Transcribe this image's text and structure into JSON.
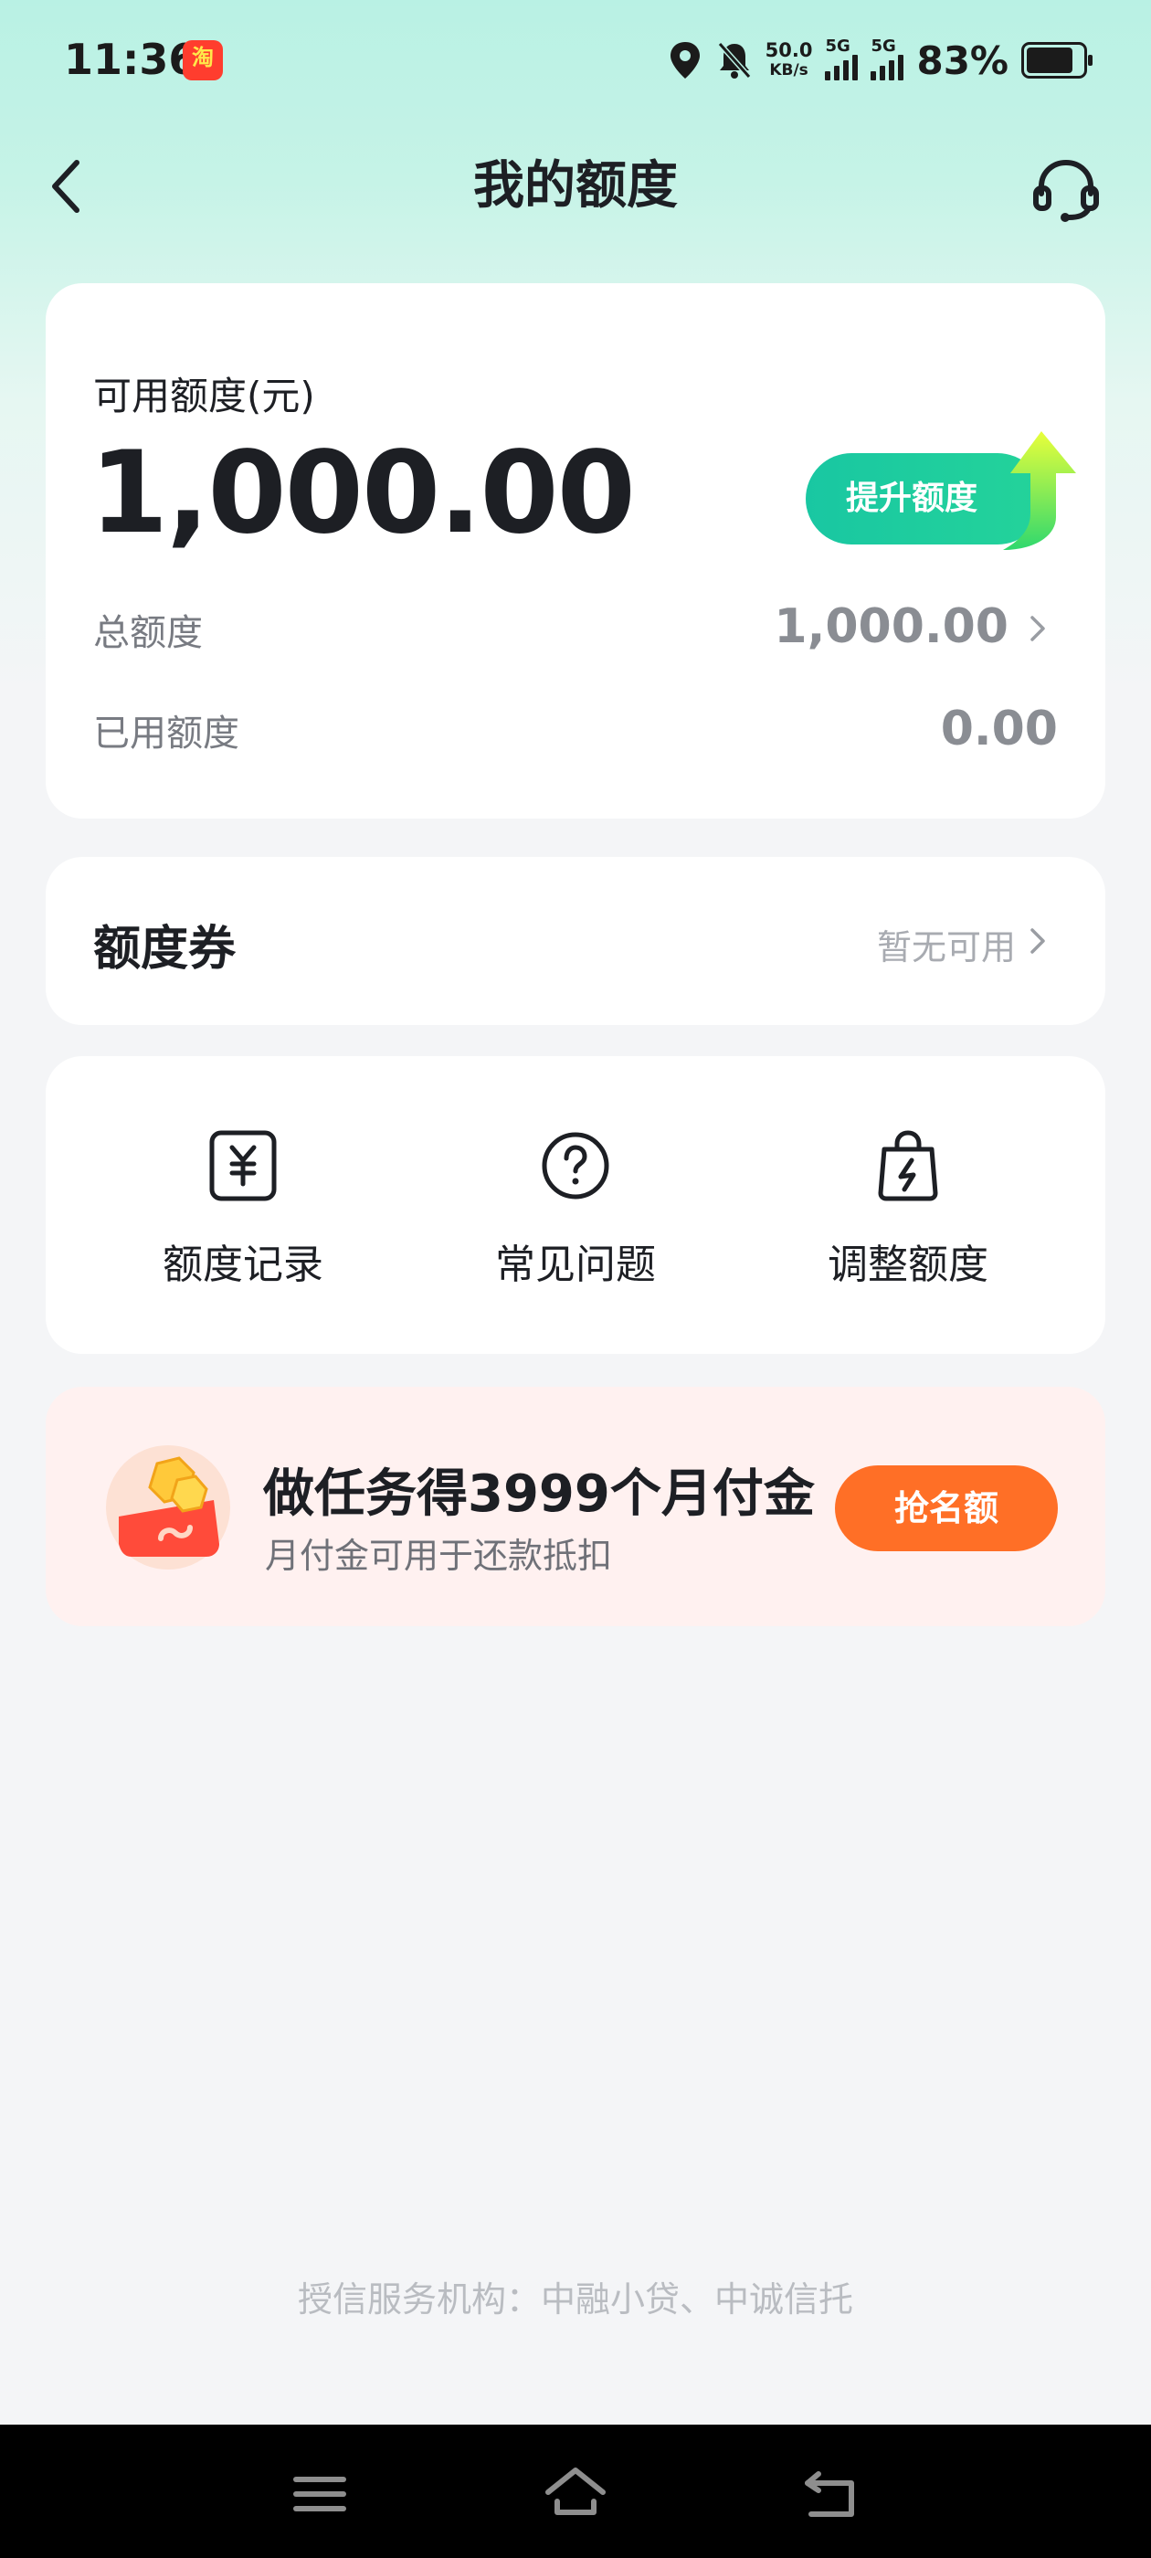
{
  "status_bar": {
    "time": "11:36",
    "app_badge": "淘",
    "net_speed_value": "50.0",
    "net_speed_unit": "KB/s",
    "sim1": "5G",
    "sim2": "5G",
    "battery_percent": "83%",
    "battery_level": 0.83
  },
  "nav": {
    "title": "我的额度",
    "back_icon": "chevron-left-icon",
    "service_icon": "headset-icon"
  },
  "credit": {
    "label": "可用额度(元)",
    "available": "1,000.00",
    "raise_button": "提升额度",
    "total_label": "总额度",
    "total_value": "1,000.00",
    "used_label": "已用额度",
    "used_value": "0.00"
  },
  "voucher": {
    "title": "额度券",
    "status": "暂无可用"
  },
  "shortcuts": [
    {
      "label": "额度记录",
      "icon": "yen-record-icon"
    },
    {
      "label": "常见问题",
      "icon": "question-circle-icon"
    },
    {
      "label": "调整额度",
      "icon": "bolt-bag-icon"
    }
  ],
  "promo": {
    "title": "做任务得3999个月付金",
    "subtitle": "月付金可用于还款抵扣",
    "button": "抢名额",
    "icon": "coin-gift-icon"
  },
  "footer": {
    "note": "授信服务机构：中融小贷、中诚信托"
  },
  "colors": {
    "accent_green": "#1fcaa0",
    "promo_orange": "#ff6f26",
    "header_mint": "#b9f1e4"
  }
}
